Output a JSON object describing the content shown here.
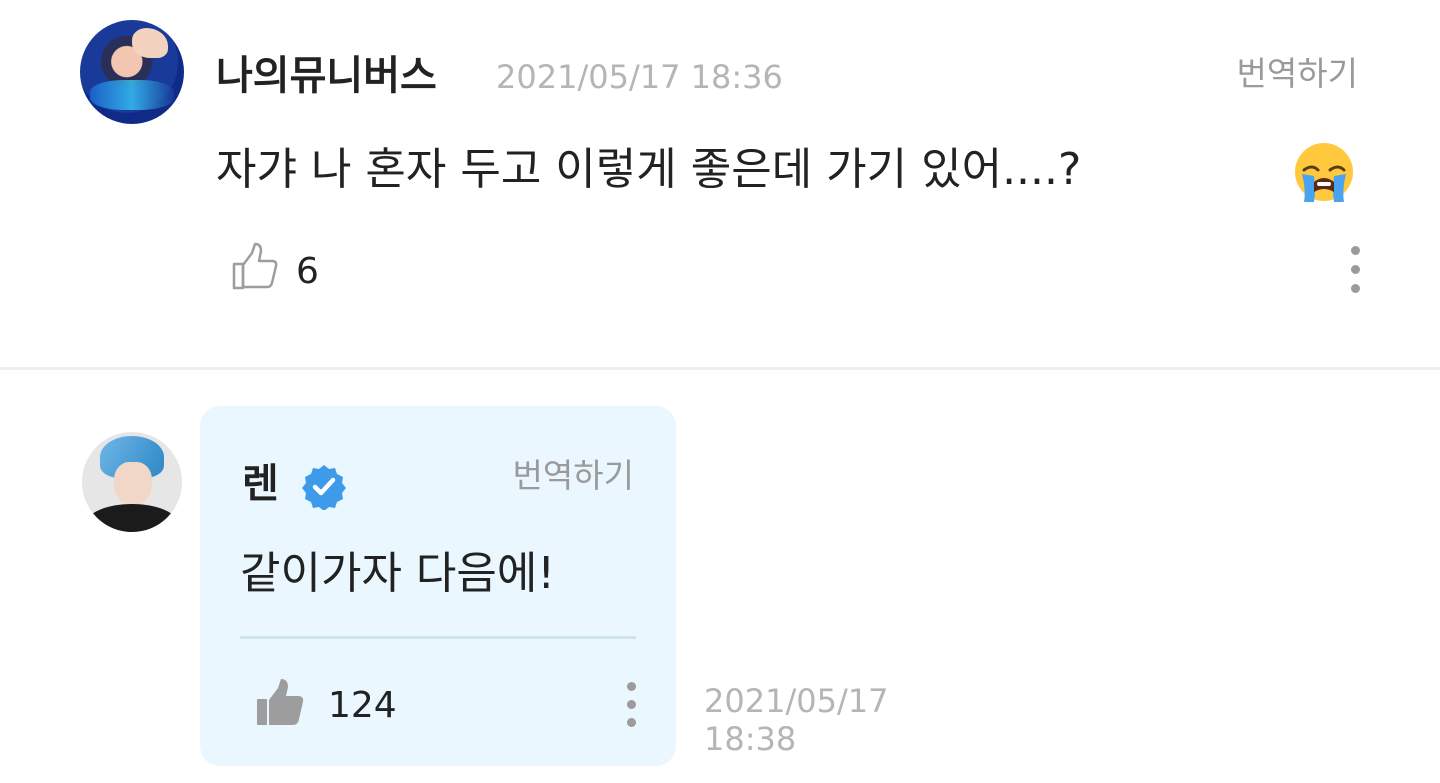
{
  "comment": {
    "username": "나의뮤니버스",
    "timestamp": "2021/05/17 18:36",
    "translate_label": "번역하기",
    "text": "자갸 나 혼자 두고 이렇게 좋은데 가기 있어....?",
    "emoji": "loudly-crying-face",
    "like_count": "6",
    "like_icon": "thumbs-up-outline-icon",
    "more_icon": "more-vertical-icon"
  },
  "reply": {
    "username": "렌",
    "verified_icon": "verified-badge-icon",
    "translate_label": "번역하기",
    "text": "같이가자 다음에!",
    "like_count": "124",
    "like_icon": "thumbs-up-filled-icon",
    "more_icon": "more-vertical-icon",
    "timestamp_date": "2021/05/17",
    "timestamp_time": "18:38",
    "bubble_color": "#eaf7fe",
    "verified_color": "#3d9be9"
  }
}
